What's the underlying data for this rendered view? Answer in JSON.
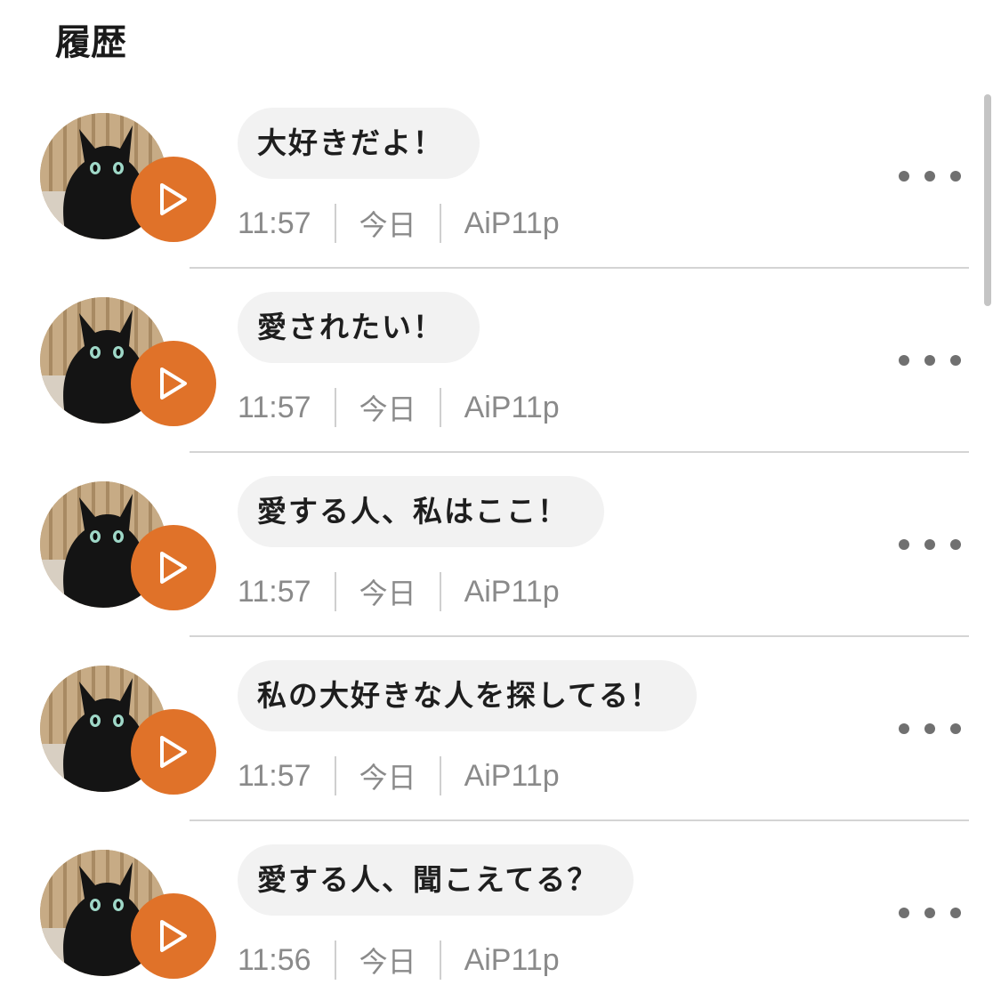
{
  "header": {
    "title": "履歴"
  },
  "history": [
    {
      "message": "大好きだよ！",
      "time": "11:57",
      "date": "今日",
      "device": "AiP11p"
    },
    {
      "message": "愛されたい！",
      "time": "11:57",
      "date": "今日",
      "device": "AiP11p"
    },
    {
      "message": "愛する人、私はここ！",
      "time": "11:57",
      "date": "今日",
      "device": "AiP11p"
    },
    {
      "message": "私の大好きな人を探してる！",
      "time": "11:57",
      "date": "今日",
      "device": "AiP11p"
    },
    {
      "message": "愛する人、聞こえてる？",
      "time": "11:56",
      "date": "今日",
      "device": "AiP11p"
    }
  ],
  "icons": {
    "play": "play-icon",
    "more": "more-horizontal-icon",
    "avatar": "black-cat-photo"
  },
  "colors": {
    "accent": "#e07229",
    "bubble": "#f2f2f2",
    "meta_text": "#8a8a8a"
  }
}
